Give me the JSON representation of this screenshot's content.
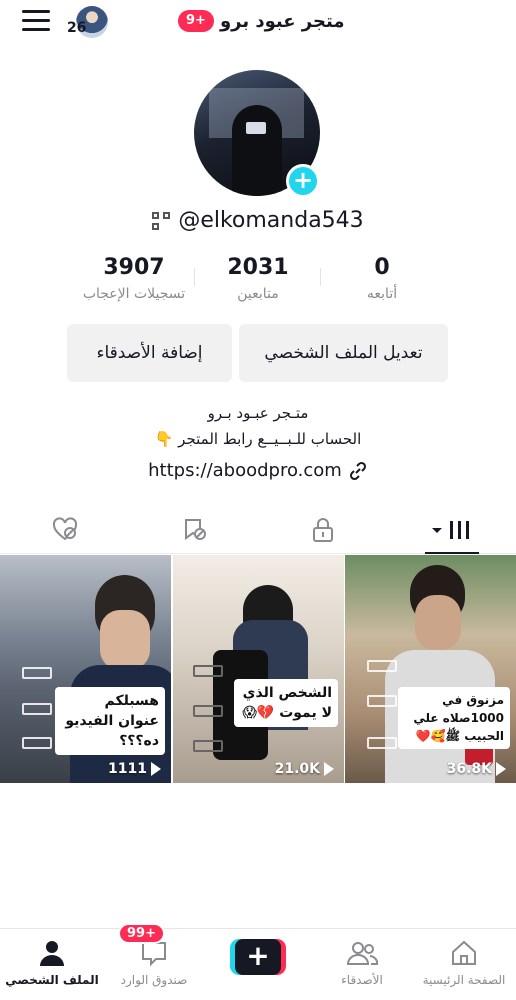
{
  "topbar": {
    "avatar_count": "26",
    "notification_badge": "9+",
    "title": "متجر عبود برو"
  },
  "profile": {
    "username": "@elkomanda543",
    "stats": [
      {
        "value": "3907",
        "label": "تسجيلات الإعجاب"
      },
      {
        "value": "2031",
        "label": "متابعين"
      },
      {
        "value": "0",
        "label": "أتابعه"
      }
    ],
    "buttons": {
      "add_friends": "إضافة الأصدقاء",
      "edit_profile": "تعديل الملف الشخصي"
    },
    "bio_line1": "متـجر عبـود بـرو",
    "bio_line2": "الحساب للـبــيــع رابط المتجر 👇",
    "link": "https://aboodpro.com"
  },
  "tabs": [
    {
      "icon": "liked-hidden-icon"
    },
    {
      "icon": "saved-hidden-icon"
    },
    {
      "icon": "lock-icon"
    },
    {
      "icon": "grid-videos-icon",
      "active": true
    }
  ],
  "videos": [
    {
      "caption": "هسبلكم عنوان الفيديو ده؟؟؟",
      "views": "1111"
    },
    {
      "caption": "الشخص الذي لا يموت 💔😱",
      "views": "21.0K"
    },
    {
      "caption": "مزنوق في 1000صلاه علي الحبيب ﷺ🥰❤️",
      "views": "36.8K"
    }
  ],
  "bottom_nav": {
    "home": "الصفحة الرئيسية",
    "friends": "الأصدقاء",
    "inbox": "صندوق الوارد",
    "inbox_badge": "99+",
    "profile": "الملف الشخصي"
  },
  "colors": {
    "accent_red": "#fe2c55",
    "accent_cyan": "#20d5ec",
    "text": "#161823"
  }
}
